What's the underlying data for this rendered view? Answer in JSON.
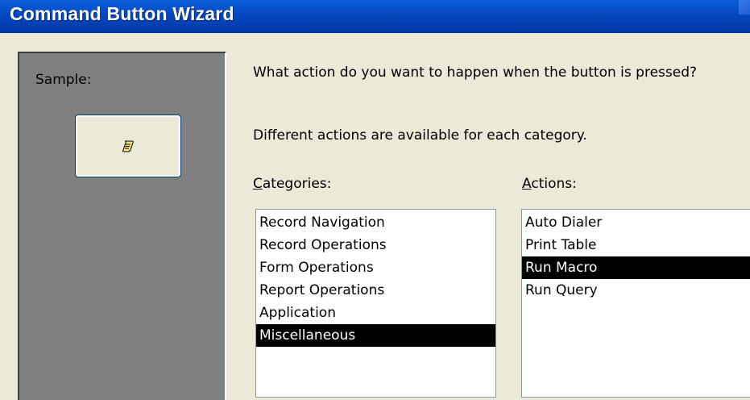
{
  "window": {
    "title": "Command Button Wizard"
  },
  "sample": {
    "label": "Sample:",
    "button_icon": "macro-scroll-icon"
  },
  "instructions": {
    "question": "What action do you want to happen when the button is pressed?",
    "hint": "Different actions are available for each category."
  },
  "categories": {
    "label_accel": "C",
    "label_rest": "ategories:",
    "items": [
      {
        "label": "Record Navigation",
        "selected": false
      },
      {
        "label": "Record Operations",
        "selected": false
      },
      {
        "label": "Form Operations",
        "selected": false
      },
      {
        "label": "Report Operations",
        "selected": false
      },
      {
        "label": "Application",
        "selected": false
      },
      {
        "label": "Miscellaneous",
        "selected": true
      }
    ]
  },
  "actions": {
    "label_accel": "A",
    "label_rest": "ctions:",
    "items": [
      {
        "label": "Auto Dialer",
        "selected": false
      },
      {
        "label": "Print Table",
        "selected": false
      },
      {
        "label": "Run Macro",
        "selected": true
      },
      {
        "label": "Run Query",
        "selected": false
      }
    ]
  },
  "colors": {
    "titlebar": "#0548c0",
    "selection_bg": "#000000",
    "sample_panel": "#808080",
    "dialog_bg": "#ece9d8"
  }
}
